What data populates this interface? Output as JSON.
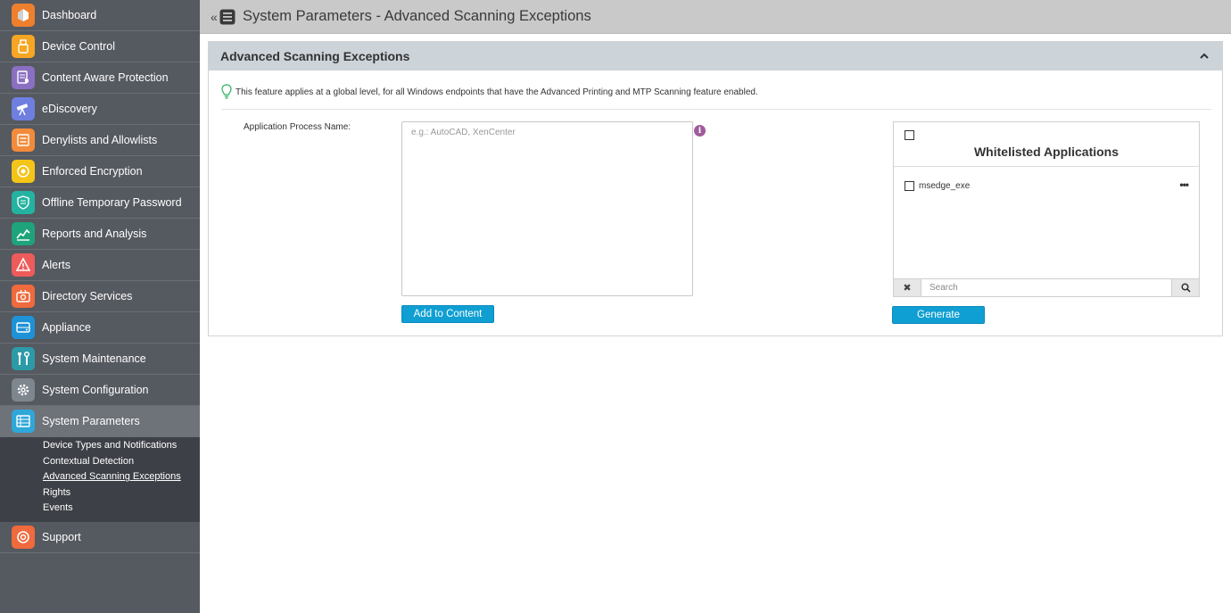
{
  "sidebar": {
    "items": [
      {
        "label": "Dashboard",
        "icon": "dashboard-icon",
        "color": "#ef7f2d"
      },
      {
        "label": "Device Control",
        "icon": "usb-icon",
        "color": "#f6a623"
      },
      {
        "label": "Content Aware Protection",
        "icon": "document-shield-icon",
        "color": "#8a6fc2"
      },
      {
        "label": "eDiscovery",
        "icon": "telescope-icon",
        "color": "#6f7fe0"
      },
      {
        "label": "Denylists and Allowlists",
        "icon": "list-icon",
        "color": "#f28b3b"
      },
      {
        "label": "Enforced Encryption",
        "icon": "lock-icon",
        "color": "#f4c418"
      },
      {
        "label": "Offline Temporary Password",
        "icon": "password-icon",
        "color": "#24b3a0"
      },
      {
        "label": "Reports and Analysis",
        "icon": "chart-icon",
        "color": "#1fa37a"
      },
      {
        "label": "Alerts",
        "icon": "alert-icon",
        "color": "#ee5b5b"
      },
      {
        "label": "Directory Services",
        "icon": "directory-icon",
        "color": "#ef6a3c"
      },
      {
        "label": "Appliance",
        "icon": "appliance-icon",
        "color": "#1e92d6"
      },
      {
        "label": "System Maintenance",
        "icon": "tools-icon",
        "color": "#2d9aa8"
      },
      {
        "label": "System Configuration",
        "icon": "gear-icon",
        "color": "#7e868e"
      },
      {
        "label": "System Parameters",
        "icon": "parameters-icon",
        "color": "#2fa7d8"
      }
    ],
    "submenu": [
      "Device Types and Notifications",
      "Contextual Detection",
      "Advanced Scanning Exceptions",
      "Rights",
      "Events"
    ],
    "support": {
      "label": "Support",
      "icon": "support-icon",
      "color": "#ef6a3c"
    }
  },
  "header": {
    "collapse_glyph": "«",
    "title": "System Parameters - Advanced Scanning Exceptions"
  },
  "panel": {
    "title": "Advanced Scanning Exceptions",
    "info_text": "This feature applies at a global level, for all Windows endpoints that have the Advanced Printing and MTP Scanning feature enabled.",
    "field_label": "Application Process Name:",
    "textarea_placeholder": "e.g.: AutoCAD, XenCenter",
    "help_glyph": "i",
    "add_button": "Add to Content",
    "whitelist": {
      "title": "Whitelisted Applications",
      "items": [
        "msedge_exe"
      ],
      "more_glyph": "•••",
      "search_placeholder": "Search",
      "clear_glyph": "✖"
    },
    "generate_button": "Generate"
  }
}
